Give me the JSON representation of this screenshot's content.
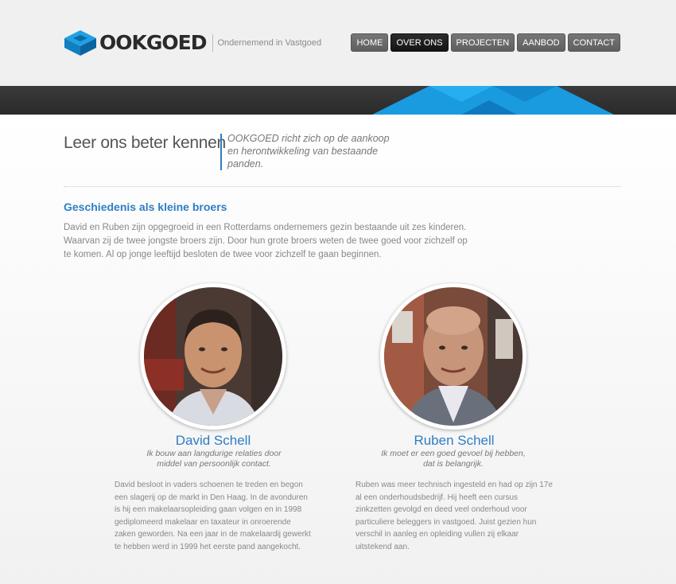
{
  "header": {
    "logo_text": "OOKGOED",
    "tagline": "Ondernemend in Vastgoed",
    "nav": [
      {
        "label": "HOME",
        "active": false
      },
      {
        "label": "OVER ONS",
        "active": true
      },
      {
        "label": "PROJECTEN",
        "active": false
      },
      {
        "label": "AANBOD",
        "active": false
      },
      {
        "label": "CONTACT",
        "active": false
      }
    ]
  },
  "page": {
    "title": "Leer ons beter kennen",
    "intro": "OOKGOED richt zich op de aankoop en herontwikkeling van bestaande panden."
  },
  "history": {
    "heading": "Geschiedenis als kleine broers",
    "text": "David en Ruben zijn opgegroeid in een Rotterdams ondernemers gezin bestaande uit zes kinderen. Waarvan zij de twee jongste broers zijn. Door hun grote broers weten de twee goed voor zichzelf op te komen. Al op jonge leeftijd besloten de twee voor zichzelf te gaan beginnen."
  },
  "people": [
    {
      "name": "David Schell",
      "quote": "Ik bouw aan langdurige relaties door middel van persoonlijk contact.",
      "bio": "David besloot in vaders schoenen te treden en begon een slagerij op de markt in Den Haag. In de avonduren is hij een makelaarsopleiding gaan volgen en in 1998 gediplomeerd makelaar en taxateur in onroerende zaken geworden. Na een jaar in de makelaardij gewerkt te hebben werd in 1999 het eerste pand aangekocht."
    },
    {
      "name": "Ruben Schell",
      "quote": "Ik moet er een goed gevoel bij hebben, dat is belangrijk.",
      "bio": "Ruben was meer technisch ingesteld en had op zijn 17e al een onderhoudsbedrijf. Hij heeft een cursus zinkzetten gevolgd en deed veel onderhoud voor particuliere beleggers in vastgoed. Juist gezien hun verschil in aanleg en opleiding vullen zij elkaar uitstekend aan."
    }
  ],
  "colors": {
    "accent": "#2f7ec4",
    "band": "#2f2f2f",
    "nav_active": "#1c1c1c",
    "nav": "#6b6b6b"
  }
}
